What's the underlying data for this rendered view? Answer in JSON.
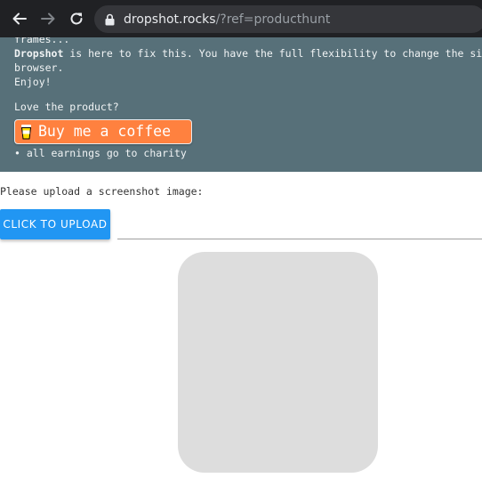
{
  "browser": {
    "url_host": "dropshot.rocks",
    "url_path": "/?ref=producthunt",
    "icons": [
      "back-arrow-icon",
      "forward-arrow-icon",
      "reload-icon",
      "lock-icon"
    ]
  },
  "banner": {
    "cut_line": "frames...",
    "brand": "Dropshot",
    "intro_rest": " is here to fix this. You have the full flexibility to change the size",
    "intro_cont": "browser.",
    "enjoy": "Enjoy!",
    "love": "Love the product?",
    "coffee_label": "Buy me a coffee",
    "charity": "• all earnings go to charity"
  },
  "upload": {
    "prompt": "Please upload a screenshot image:",
    "button_label": "CLICK TO UPLOAD"
  },
  "colors": {
    "chrome": "#202124",
    "banner": "#577079",
    "coffee": "#ff813f",
    "upload_button": "#2196f3",
    "preview": "#dddddd"
  }
}
